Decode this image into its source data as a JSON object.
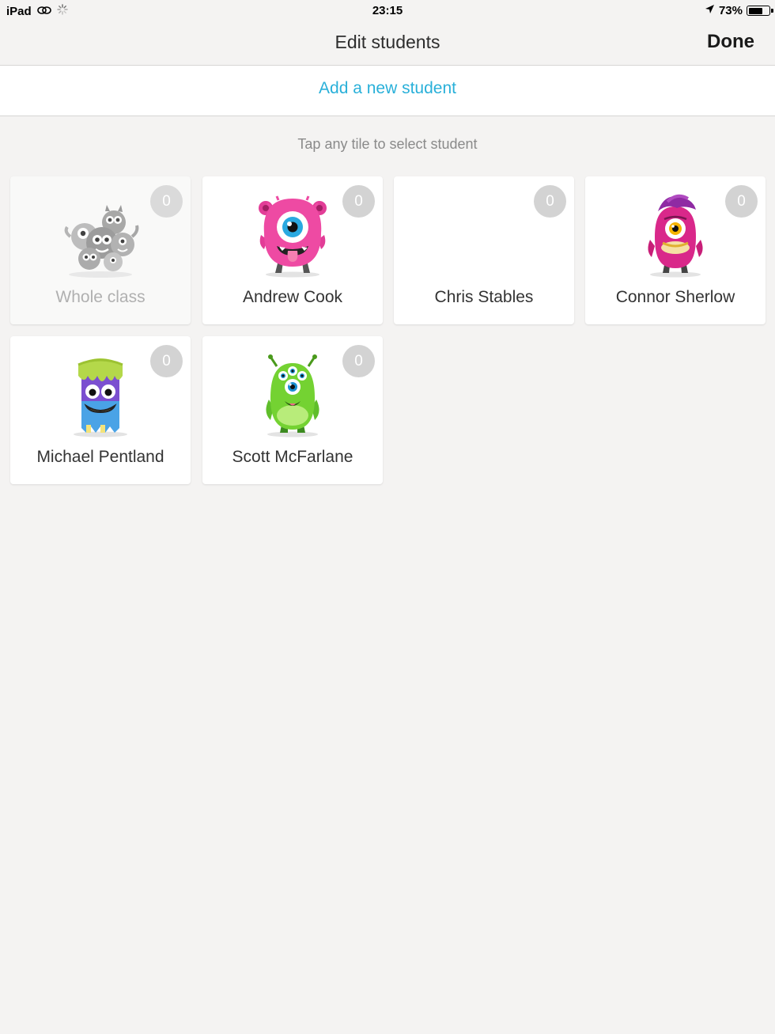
{
  "status_bar": {
    "device": "iPad",
    "time": "23:15",
    "battery_text": "73%",
    "battery_level": 0.73
  },
  "nav": {
    "title": "Edit students",
    "done_label": "Done"
  },
  "add_student_label": "Add a new student",
  "hint": "Tap any tile to select student",
  "tiles": [
    {
      "name": "Whole class",
      "points": "0"
    },
    {
      "name": "Andrew Cook",
      "points": "0"
    },
    {
      "name": "Chris Stables",
      "points": "0"
    },
    {
      "name": "Connor Sherlow",
      "points": "0"
    },
    {
      "name": "Michael Pentland",
      "points": "0"
    },
    {
      "name": "Scott McFarlane",
      "points": "0"
    }
  ],
  "colors": {
    "accent": "#29b0d9",
    "background": "#f4f3f2",
    "badge": "#d3d3d3"
  }
}
